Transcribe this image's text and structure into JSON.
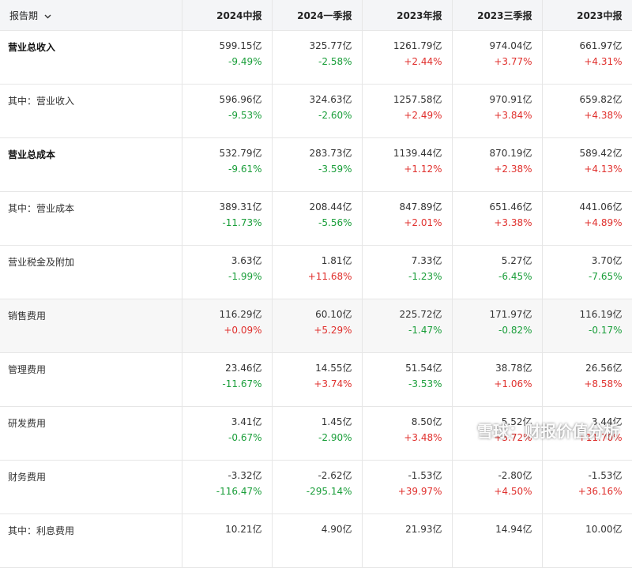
{
  "header": {
    "report_period_label": "报告期",
    "periods": [
      "2024中报",
      "2024一季报",
      "2023年报",
      "2023三季报",
      "2023中报"
    ]
  },
  "rows": [
    {
      "name": "营业总收入",
      "bold": true,
      "shaded": false,
      "values": [
        "599.15亿",
        "325.77亿",
        "1261.79亿",
        "974.04亿",
        "661.97亿"
      ],
      "changes": [
        "-9.49%",
        "-2.58%",
        "+2.44%",
        "+3.77%",
        "+4.31%"
      ]
    },
    {
      "name": "其中：营业收入",
      "bold": false,
      "shaded": false,
      "values": [
        "596.96亿",
        "324.63亿",
        "1257.58亿",
        "970.91亿",
        "659.82亿"
      ],
      "changes": [
        "-9.53%",
        "-2.60%",
        "+2.49%",
        "+3.84%",
        "+4.38%"
      ]
    },
    {
      "name": "营业总成本",
      "bold": true,
      "shaded": false,
      "values": [
        "532.79亿",
        "283.73亿",
        "1139.44亿",
        "870.19亿",
        "589.42亿"
      ],
      "changes": [
        "-9.61%",
        "-3.59%",
        "+1.12%",
        "+2.38%",
        "+4.13%"
      ]
    },
    {
      "name": "其中：营业成本",
      "bold": false,
      "shaded": false,
      "values": [
        "389.31亿",
        "208.44亿",
        "847.89亿",
        "651.46亿",
        "441.06亿"
      ],
      "changes": [
        "-11.73%",
        "-5.56%",
        "+2.01%",
        "+3.38%",
        "+4.89%"
      ]
    },
    {
      "name": "营业税金及附加",
      "bold": false,
      "shaded": false,
      "values": [
        "3.63亿",
        "1.81亿",
        "7.33亿",
        "5.27亿",
        "3.70亿"
      ],
      "changes": [
        "-1.99%",
        "+11.68%",
        "-1.23%",
        "-6.45%",
        "-7.65%"
      ]
    },
    {
      "name": "销售费用",
      "bold": false,
      "shaded": true,
      "values": [
        "116.29亿",
        "60.10亿",
        "225.72亿",
        "171.97亿",
        "116.19亿"
      ],
      "changes": [
        "+0.09%",
        "+5.29%",
        "-1.47%",
        "-0.82%",
        "-0.17%"
      ]
    },
    {
      "name": "管理费用",
      "bold": false,
      "shaded": false,
      "values": [
        "23.46亿",
        "14.55亿",
        "51.54亿",
        "38.78亿",
        "26.56亿"
      ],
      "changes": [
        "-11.67%",
        "+3.74%",
        "-3.53%",
        "+1.06%",
        "+8.58%"
      ]
    },
    {
      "name": "研发费用",
      "bold": false,
      "shaded": false,
      "values": [
        "3.41亿",
        "1.45亿",
        "8.50亿",
        "5.52亿",
        "3.44亿"
      ],
      "changes": [
        "-0.67%",
        "-2.90%",
        "+3.48%",
        "+3.72%",
        "+11.70%"
      ]
    },
    {
      "name": "财务费用",
      "bold": false,
      "shaded": false,
      "values": [
        "-3.32亿",
        "-2.62亿",
        "-1.53亿",
        "-2.80亿",
        "-1.53亿"
      ],
      "changes": [
        "-116.47%",
        "-295.14%",
        "+39.97%",
        "+4.50%",
        "+36.16%"
      ]
    },
    {
      "name": "其中：利息费用",
      "bold": false,
      "shaded": false,
      "values": [
        "10.21亿",
        "4.90亿",
        "21.93亿",
        "14.94亿",
        "10.00亿"
      ],
      "changes": [
        "",
        "",
        "",
        "",
        ""
      ]
    }
  ],
  "watermark": {
    "text": "雪球：财报价值分析",
    "icon": "snowball-logo-icon"
  },
  "colors": {
    "positive": "#e0302d",
    "negative": "#1a9e3a",
    "header_bg": "#f4f5f7",
    "border": "#e6e6e6"
  }
}
